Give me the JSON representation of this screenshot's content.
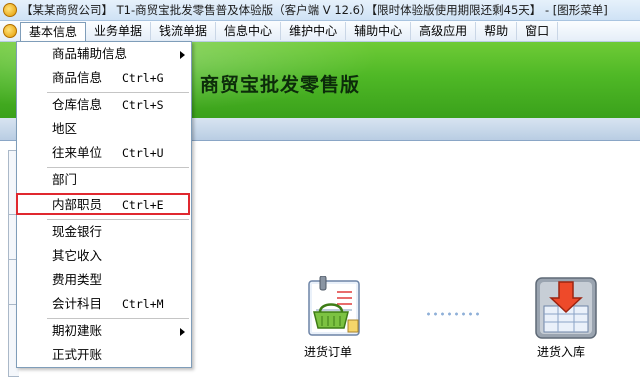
{
  "window": {
    "title": "【某某商贸公司】 T1-商贸宝批发零售普及体验版（客户端 V 12.6）【限时体验版使用期限还剩45天】 - [图形菜单]"
  },
  "menubar": {
    "items": [
      "基本信息",
      "业务单据",
      "钱流单据",
      "信息中心",
      "维护中心",
      "辅助中心",
      "高级应用",
      "帮助",
      "窗口"
    ]
  },
  "banner": {
    "title": "商贸宝批发零售版"
  },
  "dropdown": {
    "items": [
      {
        "label": "商品辅助信息",
        "shortcut": "",
        "submenu": true
      },
      {
        "label": "商品信息",
        "shortcut": "Ctrl+G",
        "submenu": false
      },
      {
        "label": "仓库信息",
        "shortcut": "Ctrl+S",
        "submenu": false
      },
      {
        "label": "地区",
        "shortcut": "",
        "submenu": false
      },
      {
        "label": "往来单位",
        "shortcut": "Ctrl+U",
        "submenu": false
      },
      {
        "label": "部门",
        "shortcut": "",
        "submenu": false
      },
      {
        "label": "内部职员",
        "shortcut": "Ctrl+E",
        "submenu": false,
        "highlighted": true
      },
      {
        "label": "现金银行",
        "shortcut": "",
        "submenu": false
      },
      {
        "label": "其它收入",
        "shortcut": "",
        "submenu": false
      },
      {
        "label": "费用类型",
        "shortcut": "",
        "submenu": false
      },
      {
        "label": "会计科目",
        "shortcut": "Ctrl+M",
        "submenu": false
      },
      {
        "label": "期初建账",
        "shortcut": "",
        "submenu": true
      },
      {
        "label": "正式开账",
        "shortcut": "",
        "submenu": false
      }
    ]
  },
  "tiles": {
    "order_label": "进货订单",
    "stockin_label": "进货入库"
  },
  "colors": {
    "banner_green": "#4fb826",
    "highlight_red": "#e0282f",
    "menu_border": "#7f9db9"
  },
  "icons": {
    "title": "app-logo-icon",
    "menu": "app-logo-icon",
    "order": "basket-document-icon",
    "stockin": "inbound-arrow-icon"
  }
}
